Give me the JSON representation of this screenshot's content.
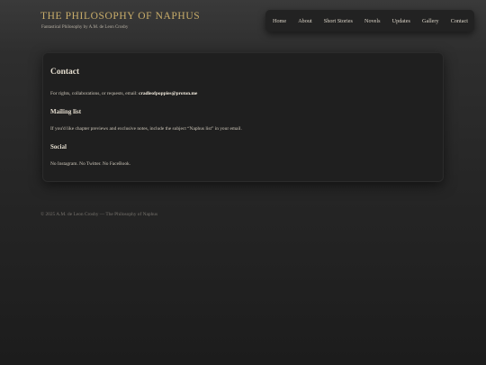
{
  "header": {
    "title": "THE PHILOSOPHY OF NAPHUS",
    "tagline": "Fantastical Philosophy by A.M. de Leon Crosby"
  },
  "nav": {
    "items": [
      "Home",
      "About",
      "Short Stories",
      "Novels",
      "Updates",
      "Gallery",
      "Contact"
    ]
  },
  "contact": {
    "heading": "Contact",
    "rights_text": "For rights, collaborations, or requests, email: ",
    "email": "cradleofpoppies@proton.me",
    "mailing_heading": "Mailing list",
    "mailing_text": "If you'd like chapter previews and exclusive notes, include the subject “Naphus list” in your email.",
    "social_heading": "Social",
    "social_text": "No Instagram. No Twitter. No FaceBook."
  },
  "footer": {
    "text": "© 2025 A.M. de Leon Crosby — The Philosophy of Naphus"
  },
  "colors": {
    "accent": "#c9ad6a",
    "background": "#262626",
    "card": "#1f1f1f"
  }
}
